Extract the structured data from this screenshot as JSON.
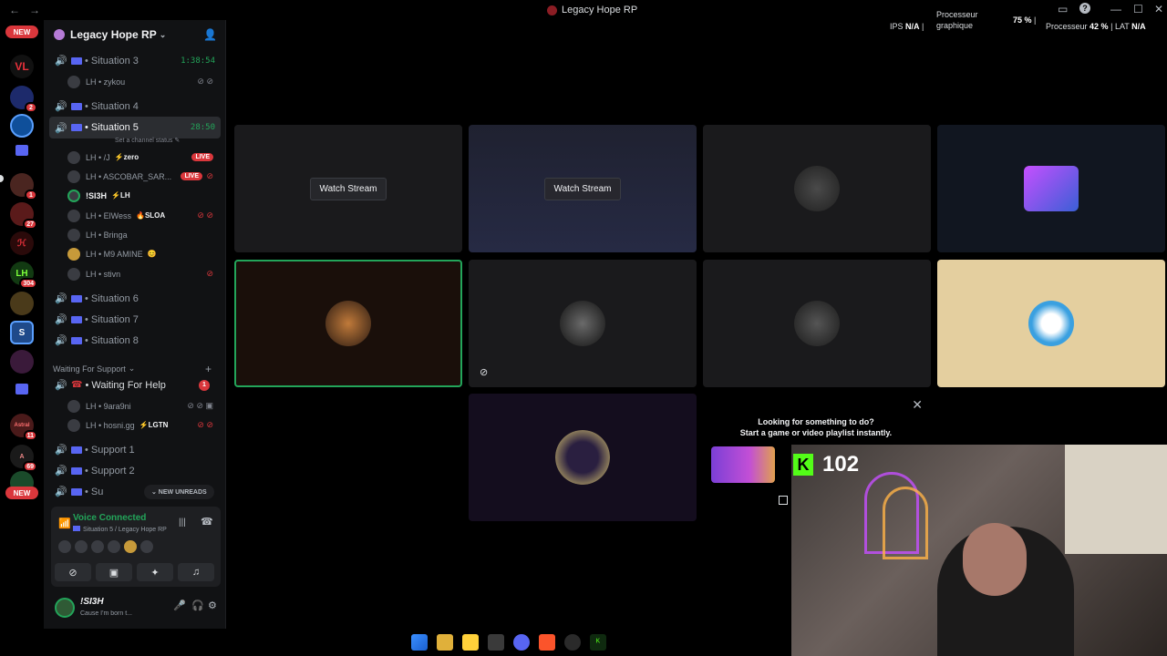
{
  "window": {
    "title": "Legacy Hope RP",
    "back": "←",
    "forward": "→",
    "controls": {
      "inbox": "▭",
      "help": "?",
      "minimize": "—",
      "maximize": "☐",
      "close": "✕"
    }
  },
  "perf": {
    "fps_label": "IPS",
    "fps_value": "N/A",
    "sep": "|",
    "gpu_label_1": "Processeur",
    "gpu_label_2": "graphique",
    "gpu_value": "75 %",
    "cpu_label": "Processeur",
    "cpu_value": "42 %",
    "lat_label": "LAT",
    "lat_value": "N/A"
  },
  "rail": {
    "new_top": "NEW",
    "new_bottom": "NEW",
    "badges": [
      "2",
      "1",
      "27",
      "304",
      "11",
      "69"
    ]
  },
  "guild": {
    "name": "Legacy Hope RP",
    "chevron": "⌄",
    "invite_icon": "person-add"
  },
  "channels": [
    {
      "name": "• Situation 3",
      "timer": "1:38:54"
    },
    {
      "name": "• Situation 4"
    },
    {
      "name": "• Situation 5",
      "timer": "28:50",
      "status": "Set a channel status ✎"
    },
    {
      "name": "• Situation 6"
    },
    {
      "name": "• Situation 7"
    },
    {
      "name": "• Situation 8"
    },
    {
      "name": "• Waiting For Help",
      "badge": "1"
    },
    {
      "name": "• Support 1"
    },
    {
      "name": "• Support 2"
    },
    {
      "name": "• Su"
    }
  ],
  "members_s3": [
    {
      "name": "LH • zykou"
    }
  ],
  "members_s5": [
    {
      "name": "LH • /J",
      "tag": "⚡zero",
      "live": "LIVE"
    },
    {
      "name": "LH • ASCOBAR_SAR...",
      "live": "LIVE"
    },
    {
      "name": "!SI3H",
      "tag": "⚡LH"
    },
    {
      "name": "LH • ElWess",
      "tag": "🔥SLOA"
    },
    {
      "name": "LH • Bringa"
    },
    {
      "name": "LH • M9 AMINE",
      "tag": "😊"
    },
    {
      "name": "LH • stivn"
    }
  ],
  "category": {
    "name": "Waiting For Support",
    "chevron": "⌄",
    "plus": "+"
  },
  "members_wait": [
    {
      "name": "LH • 9ara9ni"
    },
    {
      "name": "LH • hosni.gg",
      "tag": "⚡LGTN"
    }
  ],
  "new_unreads": "⌄ NEW UNREADS",
  "voice": {
    "title": "Voice Connected",
    "subtitle": "Situation 5 / Legacy Hope RP"
  },
  "user": {
    "name": "!SI3H",
    "status": "Cause I'm born t..."
  },
  "tiles": {
    "watch_label": "Watch Stream"
  },
  "suggest": {
    "close": "✕",
    "line1": "Looking for something to do?",
    "line2": "Start a game or video playlist instantly."
  },
  "webcam": {
    "kick_logo": "K",
    "count": "102"
  },
  "colors": {
    "accent": "#5865f2",
    "green": "#23a55a",
    "red": "#da373c",
    "kick": "#53fc18"
  }
}
